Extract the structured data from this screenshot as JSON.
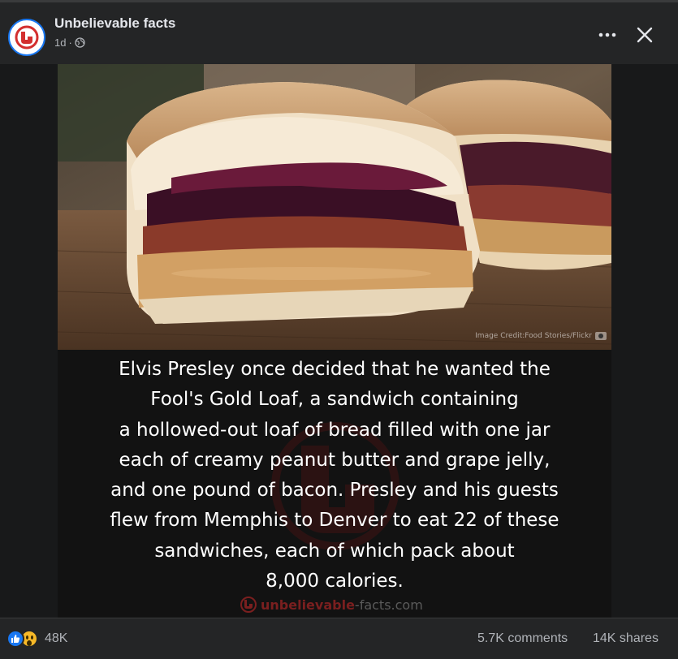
{
  "post": {
    "page_name": "Unbelievable facts",
    "time": "1d",
    "separator": "·",
    "privacy_icon": "globe-icon"
  },
  "header_actions": {
    "more_icon": "more-options-icon",
    "close_icon": "close-icon"
  },
  "image": {
    "credit": "Image Credit:Food Stories/Flickr",
    "caption_lines": [
      "Elvis Presley once decided that he wanted the",
      "Fool's Gold Loaf, a sandwich containing",
      " a hollowed-out loaf of bread filled with one jar",
      "each of creamy peanut butter and grape jelly,",
      "and one pound of bacon. Presley and his guests",
      "flew from Memphis to Denver to eat 22 of these",
      "sandwiches, each of which pack about",
      "8,000 calories."
    ],
    "brand_part1": "unbelievable",
    "brand_part2": "-facts.com"
  },
  "engagement": {
    "reaction_count": "48K",
    "comments": "5.7K comments",
    "shares": "14K shares",
    "reaction_icons": [
      "like-icon",
      "wow-icon"
    ]
  },
  "colors": {
    "background": "#242526",
    "accent": "#1877f2",
    "brand_red": "#c62828"
  }
}
